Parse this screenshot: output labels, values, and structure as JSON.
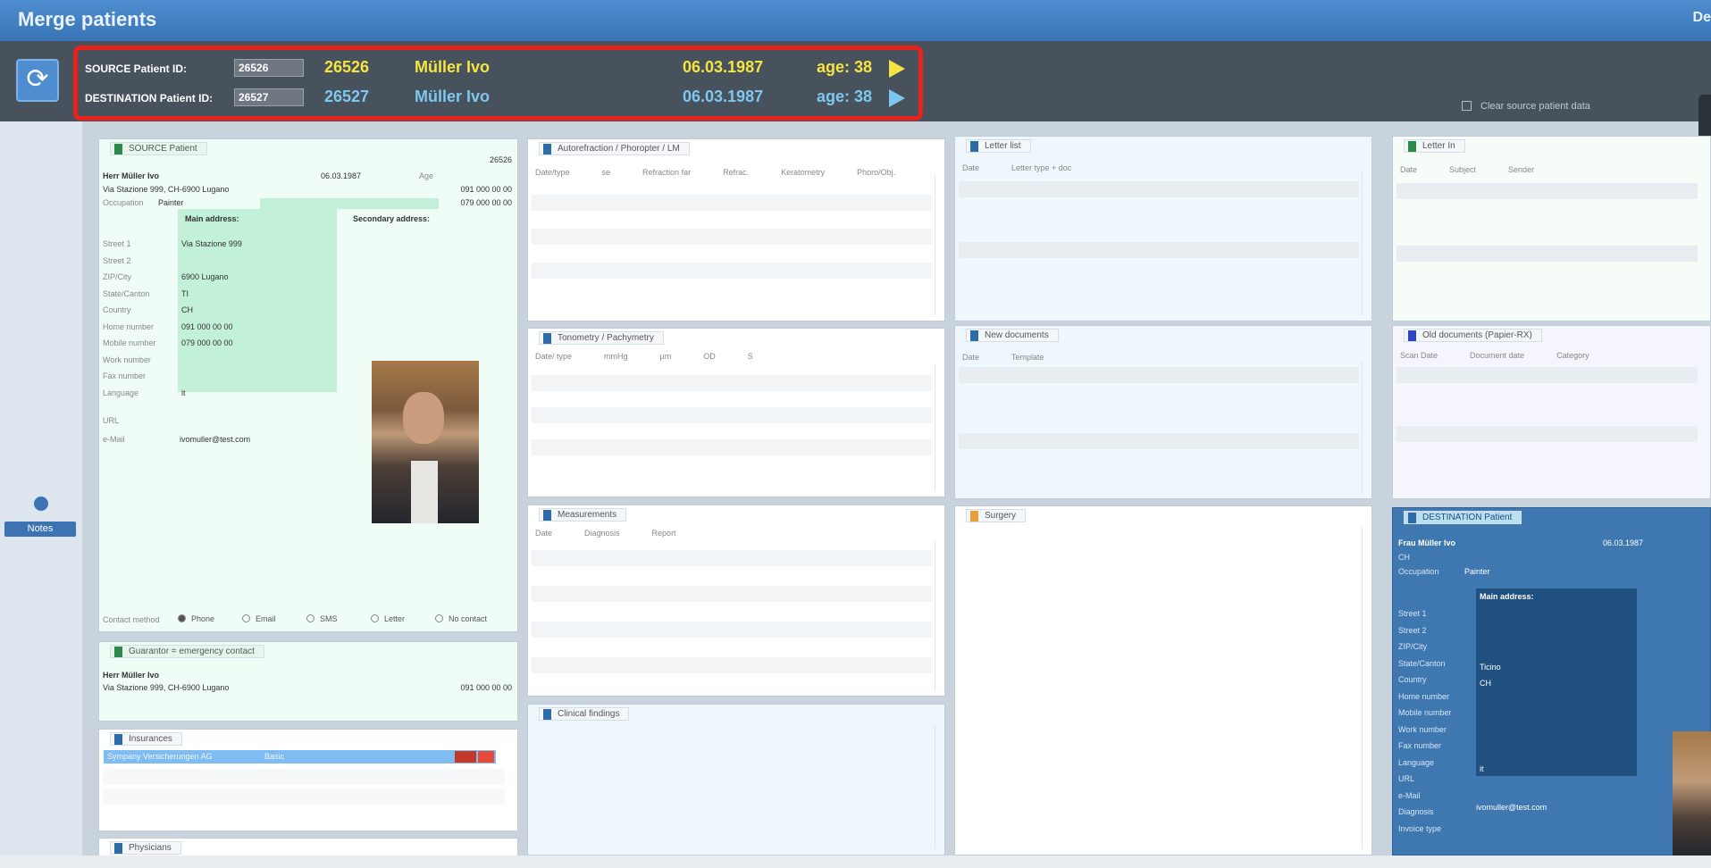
{
  "window": {
    "title": "Merge patients",
    "right_text": "De"
  },
  "header": {
    "source": {
      "label": "SOURCE Patient ID:",
      "input_value": "26526",
      "id": "26526",
      "name": "Müller Ivo",
      "dob": "06.03.1987",
      "age": "age: 38"
    },
    "destination": {
      "label": "DESTINATION Patient ID:",
      "input_value": "26527",
      "id": "26527",
      "name": "Müller Ivo",
      "dob": "06.03.1987",
      "age": "age: 38"
    },
    "clear_source": "Clear source patient data",
    "colors": {
      "source": "#f4e542",
      "destination": "#7ec8ef",
      "highlight": "#e8231c"
    }
  },
  "left_rail": {
    "notes_label": "Notes"
  },
  "panels": {
    "source_patient": {
      "title": "SOURCE Patient",
      "id": "26526",
      "name": "Herr Müller Ivo",
      "dob": "06.03.1987",
      "age_label": "Age",
      "address": "Via Stazione 999, CH-6900 Lugano",
      "phone": "091 000 00 00",
      "mobile": "079 000 00 00",
      "occupation_label": "Occupation",
      "occupation": "Painter",
      "main_address_title": "Main address:",
      "secondary_address_title": "Secondary address:",
      "fields": [
        "Street 1",
        "Street 2",
        "ZIP/City",
        "State/Canton",
        "Country",
        "Home number",
        "Mobile number",
        "Work number",
        "Fax number",
        "Language"
      ],
      "main_values": [
        "Via Stazione 999",
        "",
        "6900       Lugano",
        "TI",
        "CH",
        "091 000 00 00",
        "079 000 00 00",
        "",
        "",
        "it"
      ],
      "email_label": "e-Mail",
      "email": "ivomuller@test.com",
      "contact_method_label": "Contact method",
      "contact_options": [
        "Phone",
        "Email",
        "SMS",
        "Letter",
        "No contact"
      ]
    },
    "guarantor": {
      "title": "Guarantor = emergency contact",
      "name": "Herr Müller Ivo",
      "address": "Via Stazione 999, CH-6900 Lugano",
      "phone": "091 000 00 00"
    },
    "insurances": {
      "title": "Insurances",
      "row": "Sympany Versicherungen AG",
      "row_type": "Basic"
    },
    "physicians": {
      "title": "Physicians"
    },
    "autorefraction": {
      "title": "Autorefraction / Phoropter / LM",
      "columns": [
        "Date/type",
        "se",
        "Refraction far",
        "Refrac.",
        "Keratometry",
        "Phoro/Obj."
      ]
    },
    "tonometry": {
      "title": "Tonometry / Pachymetry",
      "columns": [
        "Date/ type",
        "mmHg",
        "µm",
        "OD",
        "S"
      ]
    },
    "measurements": {
      "title": "Measurements",
      "columns": [
        "Date",
        "Diagnosis",
        "Report"
      ]
    },
    "clinical_findings": {
      "title": "Clinical findings"
    },
    "letter_list": {
      "title": "Letter list",
      "columns": [
        "Date",
        "Letter type + doc"
      ]
    },
    "new_documents": {
      "title": "New documents",
      "columns": [
        "Date",
        "Template"
      ]
    },
    "surgery": {
      "title": "Surgery"
    },
    "letter_in": {
      "title": "Letter In",
      "columns": [
        "Date",
        "Subject",
        "Sender"
      ]
    },
    "old_documents": {
      "title": "Old documents (Papier-RX)",
      "columns": [
        "Scan Date",
        "Document date",
        "Category"
      ]
    },
    "destination_patient": {
      "title": "DESTINATION Patient",
      "name": "Frau Müller Ivo",
      "country": "CH",
      "dob": "06.03.1987",
      "occupation_label": "Occupation",
      "occupation": "Painter",
      "main_address_title": "Main address:",
      "fields": [
        "Street 1",
        "Street 2",
        "ZIP/City",
        "State/Canton",
        "Country",
        "Home number",
        "Mobile number",
        "Work number",
        "Fax number",
        "Language",
        "URL",
        "e-Mail",
        "Diagnosis",
        "Invoice type"
      ],
      "state": "Ticino",
      "country_value": "CH",
      "language": "it",
      "email": "ivomuller@test.com"
    }
  }
}
